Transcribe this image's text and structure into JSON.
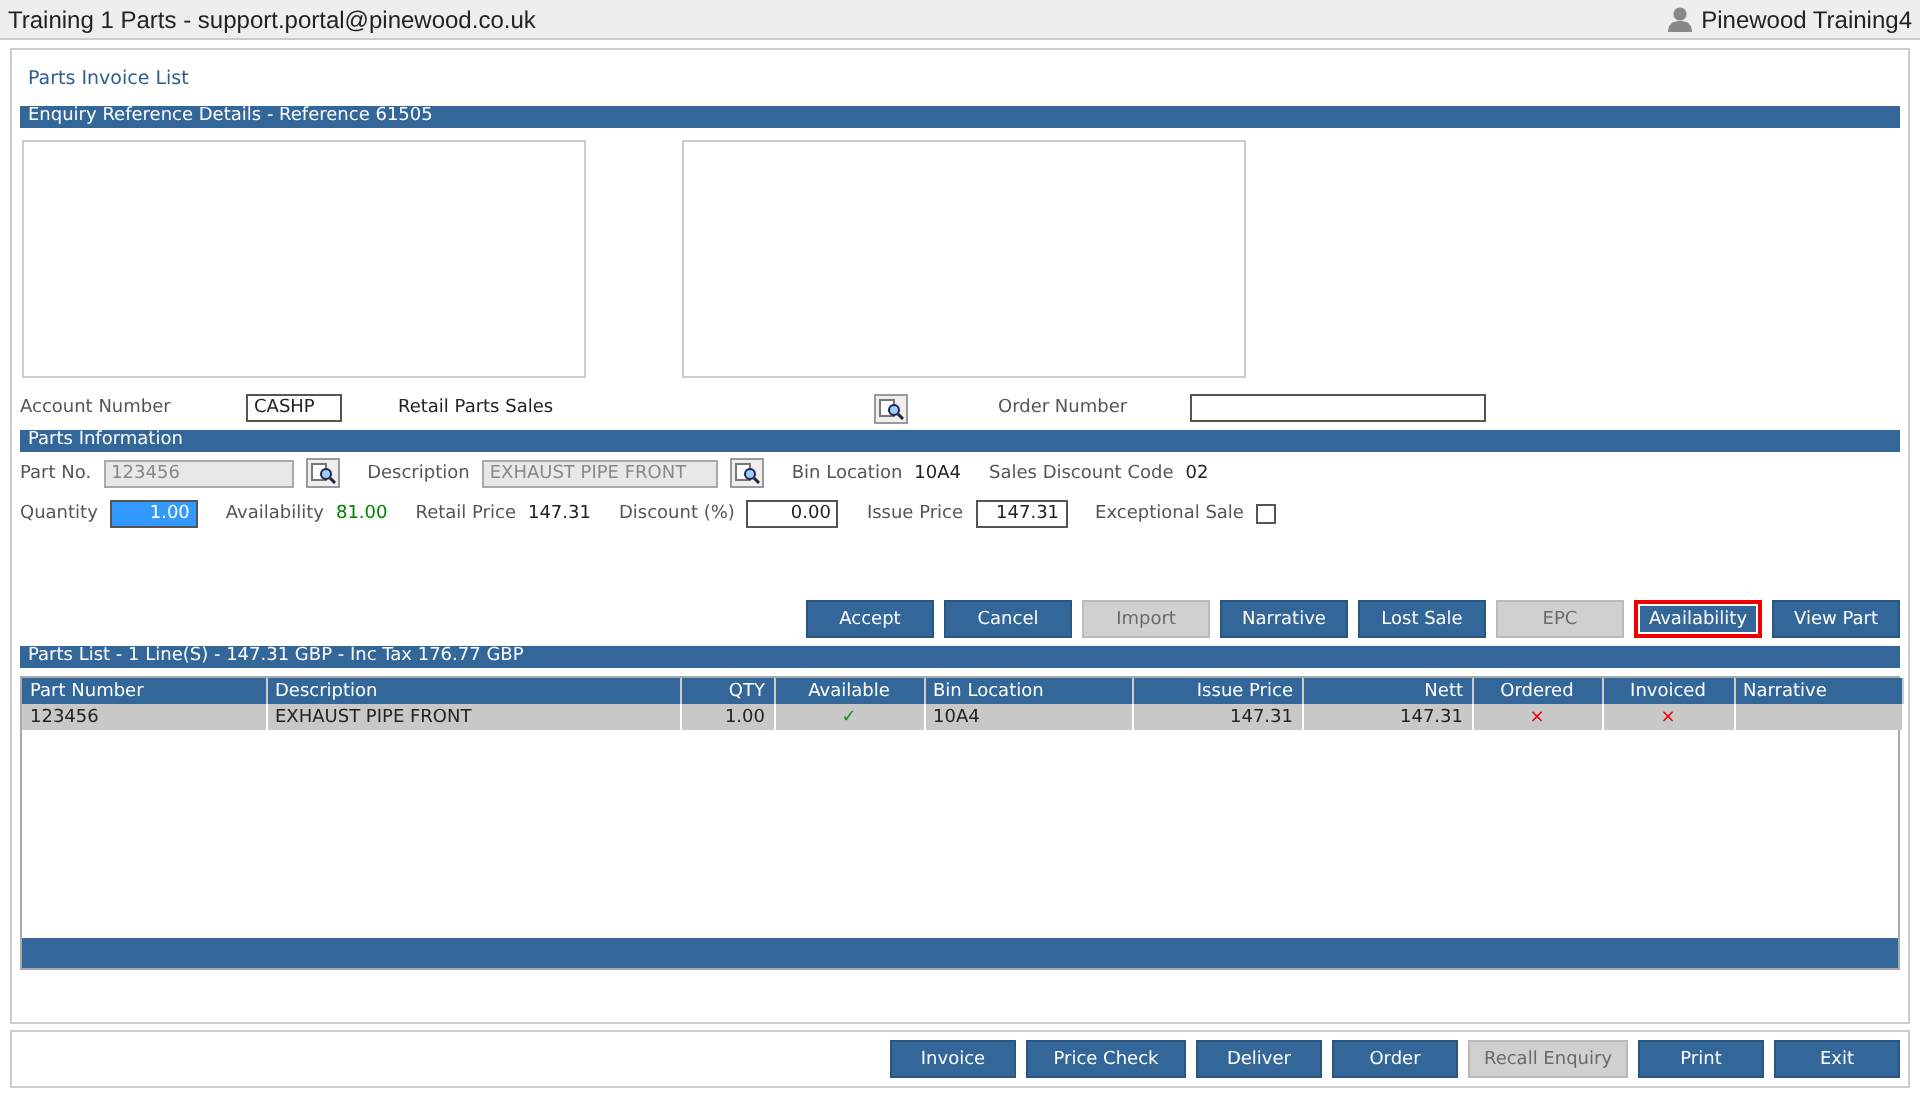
{
  "window": {
    "title": "Training 1 Parts - support.portal@pinewood.co.uk",
    "user": "Pinewood Training4"
  },
  "page_title": "Parts Invoice List",
  "enquiry": {
    "header": "Enquiry Reference Details  -  Reference 61505",
    "account_label": "Account Number",
    "account_value": "CASHP",
    "account_name": "Retail Parts Sales",
    "order_label": "Order Number"
  },
  "parts_info": {
    "header": "Parts Information",
    "top_line": [
      {
        "kind": "lookup-field",
        "label": "Part No.",
        "value": "123456",
        "disabled": true
      },
      {
        "kind": "lookup-field",
        "label": "Description",
        "value": "EXHAUST PIPE FRONT",
        "disabled": true
      },
      {
        "kind": "text",
        "label": "Bin Location",
        "value": "10A4"
      },
      {
        "kind": "text",
        "label": "Sales Discount Code",
        "value": "02"
      }
    ],
    "bottom_line": [
      {
        "kind": "field",
        "label": "Quantity",
        "value": "1.00",
        "disabled": false,
        "highlighted": true
      },
      {
        "kind": "text",
        "label": "Availability",
        "value": "81.00",
        "color": "#008000"
      },
      {
        "kind": "text",
        "label": "Retail Price",
        "value": "147.31"
      },
      {
        "kind": "field",
        "label": "Discount (%)",
        "value": "0.00",
        "disabled": false
      },
      {
        "kind": "field",
        "label": "Issue Price",
        "value": "147.31",
        "disabled": false
      },
      {
        "kind": "checkbox",
        "label": "Exceptional Sale",
        "checked": false
      }
    ]
  },
  "action_buttons": [
    {
      "label": "Accept",
      "disabled": false,
      "highlighted": false
    },
    {
      "label": "Cancel",
      "disabled": false,
      "highlighted": false
    },
    {
      "label": "Import",
      "disabled": true,
      "highlighted": false
    },
    {
      "label": "Narrative",
      "disabled": false,
      "highlighted": false
    },
    {
      "label": "Lost Sale",
      "disabled": false,
      "highlighted": false
    },
    {
      "label": "EPC",
      "disabled": true,
      "highlighted": false
    },
    {
      "label": "Availability",
      "disabled": false,
      "highlighted": true
    },
    {
      "label": "View Part",
      "disabled": false,
      "highlighted": false
    }
  ],
  "parts_list": {
    "header": "Parts List - 1 Line(S) - 147.31 GBP - Inc Tax 176.77 GBP",
    "columns": [
      "Part Number",
      "Description",
      "QTY",
      "Available",
      "Bin Location",
      "Issue Price",
      "Nett",
      "Ordered",
      "Invoiced",
      "Narrative"
    ],
    "rows": [
      {
        "selected": true,
        "cells": [
          "123456",
          "EXHAUST PIPE FRONT",
          "1.00",
          "✓",
          "10A4",
          "147.31",
          "147.31",
          "×",
          "×",
          ""
        ]
      }
    ]
  },
  "bottom_buttons": [
    {
      "label": "Invoice",
      "disabled": false
    },
    {
      "label": "Price Check",
      "disabled": false
    },
    {
      "label": "Deliver",
      "disabled": false
    },
    {
      "label": "Order",
      "disabled": false
    },
    {
      "label": "Recall Enquiry",
      "disabled": true
    },
    {
      "label": "Print",
      "disabled": false
    },
    {
      "label": "Exit",
      "disabled": false
    }
  ]
}
